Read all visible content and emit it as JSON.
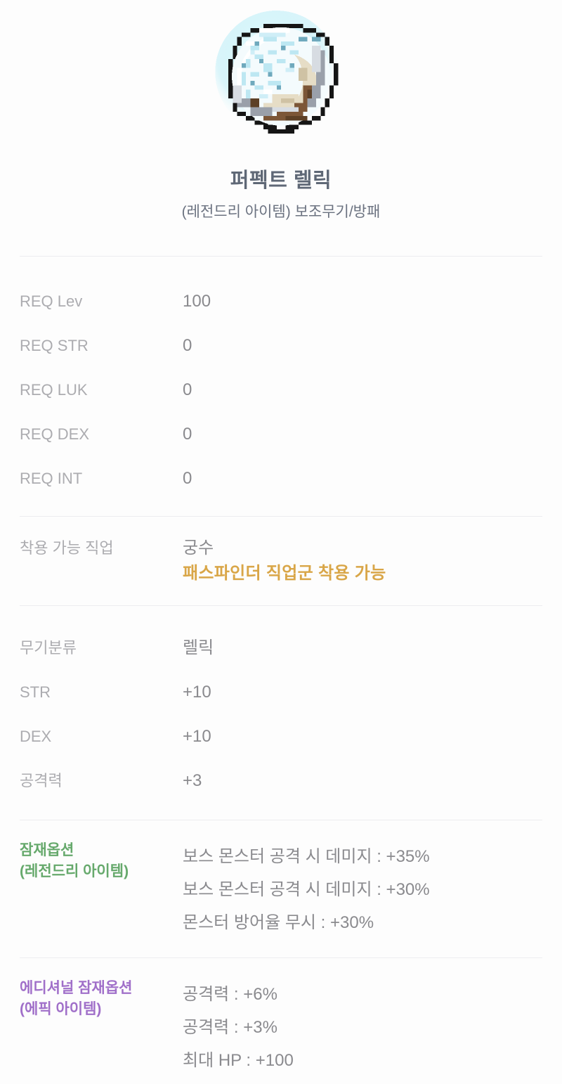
{
  "item": {
    "icon_name": "relic-orb-icon",
    "title": "퍼펙트 렐릭",
    "subtitle": "(레전드리 아이템) 보조무기/방패"
  },
  "requirements": {
    "rows": [
      {
        "label": "REQ Lev",
        "value": "100"
      },
      {
        "label": "REQ STR",
        "value": "0"
      },
      {
        "label": "REQ LUK",
        "value": "0"
      },
      {
        "label": "REQ DEX",
        "value": "0"
      },
      {
        "label": "REQ INT",
        "value": "0"
      }
    ]
  },
  "job": {
    "label": "착용 가능 직업",
    "primary": "궁수",
    "extra": "패스파인더 직업군 착용 가능",
    "extra_color": "#d9a648"
  },
  "weapon": {
    "rows": [
      {
        "label": "무기분류",
        "value": "렐릭"
      },
      {
        "label": "STR",
        "value": "+10"
      },
      {
        "label": "DEX",
        "value": "+10"
      },
      {
        "label": "공격력",
        "value": "+3"
      }
    ]
  },
  "potential": {
    "label_line1": "잠재옵션",
    "label_line2": "(레전드리 아이템)",
    "label_color": "#66a96c",
    "lines": [
      "보스 몬스터 공격 시 데미지 : +35%",
      "보스 몬스터 공격 시 데미지 : +30%",
      "몬스터 방어율 무시 : +30%"
    ]
  },
  "additional_potential": {
    "label_line1": "에디셔널 잠재옵션",
    "label_line2": "(에픽 아이템)",
    "label_color": "#a06fc9",
    "lines": [
      "공격력 : +6%",
      "공격력 : +3%",
      "최대 HP : +100"
    ]
  },
  "colors": {
    "background": "#fdfdfd",
    "title": "#5f6876",
    "label": "#acacb0",
    "value": "#8a8a8e",
    "divider": "#ededf0"
  }
}
